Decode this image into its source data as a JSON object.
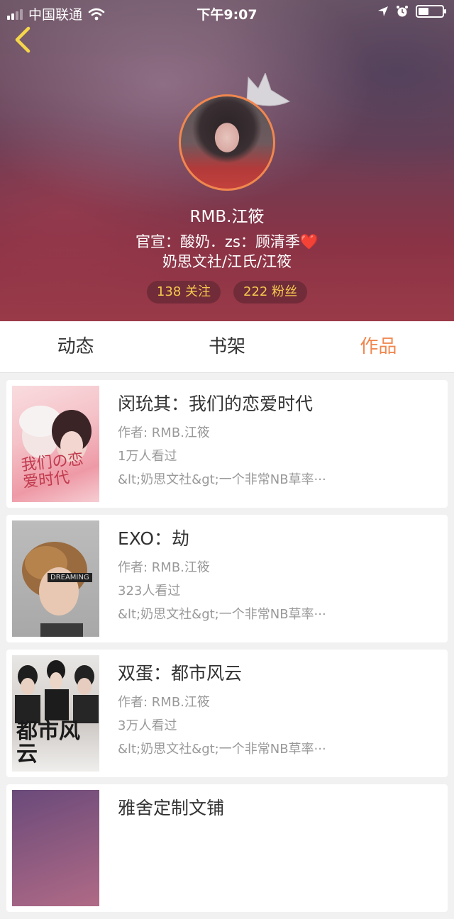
{
  "status_bar": {
    "carrier": "中国联通",
    "time": "下午9:07",
    "battery_level": 0.45
  },
  "profile": {
    "username": "RMB.江筱",
    "bio_line1": "官宣：酸奶．zs：顾清季",
    "bio_heart": "❤️",
    "bio_line2": "奶思文社/江氏/江筱",
    "following": "138 关注",
    "followers": "222 粉丝"
  },
  "tabs": [
    {
      "label": "动态",
      "active": false
    },
    {
      "label": "书架",
      "active": false
    },
    {
      "label": "作品",
      "active": true
    }
  ],
  "books": [
    {
      "title": "闵玧其：我们的恋爱时代",
      "author": "作者: RMB.江筱",
      "views": "1万人看过",
      "desc": "&lt;奶思文社&gt;一个非常NB草率···",
      "cover_text": "我们の恋爱时代"
    },
    {
      "title": "EXO：劫",
      "author": "作者: RMB.江筱",
      "views": "323人看过",
      "desc": "&lt;奶思文社&gt;一个非常NB草率···",
      "cover_text": "DREAMING"
    },
    {
      "title": "双蛋：都市风云",
      "author": "作者: RMB.江筱",
      "views": "3万人看过",
      "desc": "&lt;奶思文社&gt;一个非常NB草率···",
      "cover_text": "都市风云"
    },
    {
      "title": "雅舍定制文铺",
      "author": "",
      "views": "",
      "desc": "",
      "cover_text": ""
    }
  ],
  "colors": {
    "accent": "#f0874f",
    "pill_text": "#f5c94e",
    "heart": "#e3262d"
  }
}
